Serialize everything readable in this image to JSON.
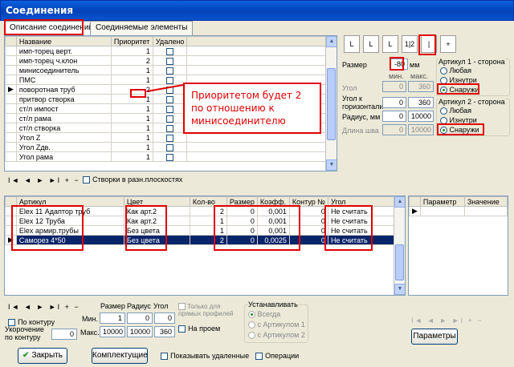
{
  "window": {
    "title": "Соединения"
  },
  "tabs": [
    {
      "label": "Описание соединений"
    },
    {
      "label": "Соединяемые элементы"
    }
  ],
  "top_grid": {
    "headers": {
      "name": "Название",
      "priority": "Приоритет",
      "deleted": "Удалено"
    },
    "rows": [
      {
        "name": "имп-торец верт.",
        "priority": "1"
      },
      {
        "name": "имп-торец ч.клон",
        "priority": "2"
      },
      {
        "name": "минисоединитель",
        "priority": "1"
      },
      {
        "name": "ПМС",
        "priority": "1"
      },
      {
        "name": "поворотная труб",
        "priority": "2"
      },
      {
        "name": "притвор створка",
        "priority": "1"
      },
      {
        "name": "ст/л импост",
        "priority": "1"
      },
      {
        "name": "ст/л рама",
        "priority": "1"
      },
      {
        "name": "ст/л створка",
        "priority": "1"
      },
      {
        "name": "Угол Z",
        "priority": "1"
      },
      {
        "name": "Угол Zдв.",
        "priority": "1"
      },
      {
        "name": "Угол рама",
        "priority": "1"
      }
    ],
    "current_row_index": 4
  },
  "nav": {
    "glyphs": "I◄ ◄ ► ►I + −"
  },
  "flaps_checkbox": {
    "label": "Створки в разн.плоскостях"
  },
  "callout": {
    "text": "Приоритетом будет 2 по отношению к минисоединителю"
  },
  "dims": {
    "size": {
      "label": "Размер",
      "value": "-80",
      "unit": "мм"
    },
    "min_label": "мин.",
    "max_label": "макс.",
    "angle": {
      "label": "Угол",
      "min": "0",
      "max": "360"
    },
    "angle_horizon": {
      "label": "Угол к горизонтали",
      "min": "0",
      "max": "360"
    },
    "radius": {
      "label": "Радиус, мм",
      "min": "0",
      "max": "10000"
    },
    "seam": {
      "label": "Длина шва",
      "min": "0",
      "max": "10000"
    }
  },
  "profile_icons": [
    "L",
    "L",
    "L",
    "1|2",
    "|",
    "+"
  ],
  "article1": {
    "title": "Артикул 1 - сторона",
    "options": [
      "Любая",
      "Изнутри",
      "Снаружи"
    ],
    "selected": 2
  },
  "article2": {
    "title": "Артикул 2 - сторона",
    "options": [
      "Любая",
      "Изнутри",
      "Снаружи"
    ],
    "selected": 2
  },
  "bottom_grid": {
    "headers": {
      "article": "Артикул",
      "color": "Цвет",
      "qty": "Кол-во",
      "size": "Размер",
      "coef": "Коэфф.",
      "contour": "Контур №",
      "angle": "Угол"
    },
    "rows": [
      {
        "article": "Elex 11 Адаптор труб",
        "color": "Как арт.2",
        "qty": "2",
        "size": "0",
        "coef": "0,001",
        "contour": "0",
        "angle": "Не считать"
      },
      {
        "article": "Elex 12 Труба",
        "color": "Как арт.2",
        "qty": "1",
        "size": "0",
        "coef": "0,001",
        "contour": "0",
        "angle": "Не считать"
      },
      {
        "article": "Elex армир.трубы",
        "color": "Без цвета",
        "qty": "1",
        "size": "0",
        "coef": "0,001",
        "contour": "0",
        "angle": "Не считать"
      },
      {
        "article": "Саморез 4*50",
        "color": "Без цвета",
        "qty": "2",
        "size": "0",
        "coef": "0,0025",
        "contour": "0",
        "angle": "Не считать"
      }
    ],
    "current_row_index": 3
  },
  "params_grid": {
    "headers": {
      "param": "Параметр",
      "value": "Значение"
    }
  },
  "bottom_controls": {
    "contour_label": "По контуру",
    "shortening_label": "Укорочение по контуру",
    "shortening_value": "0",
    "col_size": "Размер",
    "col_radius": "Радиус",
    "col_angle": "Угол",
    "min_label": "Мин.",
    "max_label": "Макс.",
    "min_vals": [
      "1",
      "0",
      "0"
    ],
    "max_vals": [
      "10000",
      "10000",
      "360"
    ],
    "straight_only": "Только для прямых профилей",
    "on_span": "На проем",
    "install_title": "Устанавливать",
    "install_options": [
      "Всегда",
      "с Артикулом 1",
      "с Артикулом 2"
    ]
  },
  "buttons": {
    "close": "Закрыть",
    "kit": "Комплектущие",
    "show_deleted": "Показывать удаленные",
    "operations": "Операции",
    "params": "Параметры"
  }
}
